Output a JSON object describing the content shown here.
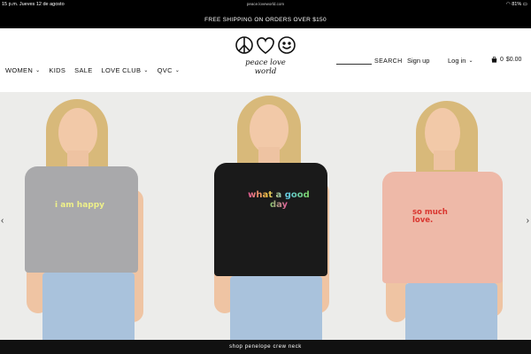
{
  "status_bar": {
    "time_date": "15 p.m.  Jueves 12 de agosto",
    "url": "peace.loveworld.com",
    "battery": "81%"
  },
  "promo_banner": "FREE SHIPPING ON ORDERS OVER $150",
  "nav": {
    "items": [
      {
        "label": "WOMEN",
        "has_menu": true
      },
      {
        "label": "KIDS",
        "has_menu": false
      },
      {
        "label": "SALE",
        "has_menu": false
      },
      {
        "label": "LOVE CLUB",
        "has_menu": true
      },
      {
        "label": "QVC",
        "has_menu": true
      }
    ]
  },
  "logo": {
    "text": "peace love world",
    "icons": [
      "peace-icon",
      "heart-icon",
      "smiley-icon"
    ]
  },
  "header": {
    "search_label": "SEARCH",
    "signup_label": "Sign up",
    "login_label": "Log in",
    "cart_count": "0",
    "cart_total": "$0.00"
  },
  "hero": {
    "shirts": [
      {
        "text": "i am happy",
        "color": "#a9a9ab"
      },
      {
        "text": "what a good day",
        "color": "#1a1a1a"
      },
      {
        "text": "so much love.",
        "color": "#eeb9a8"
      }
    ],
    "cta": "shop penelope crew neck"
  },
  "colors": {
    "black": "#000000",
    "hero_bg": "#ececea"
  }
}
